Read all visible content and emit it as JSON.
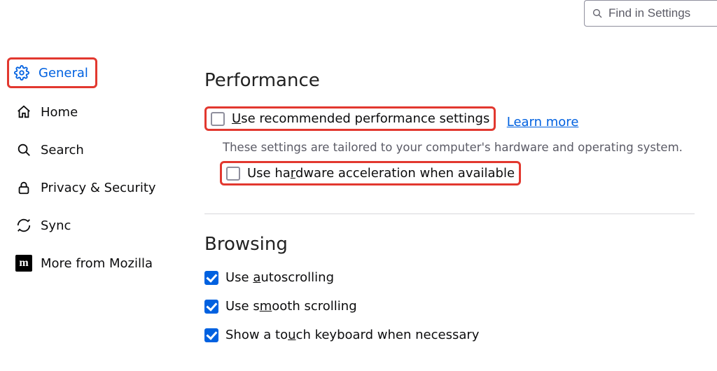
{
  "search": {
    "placeholder": "Find in Settings"
  },
  "sidebar": {
    "items": [
      {
        "label": "General"
      },
      {
        "label": "Home"
      },
      {
        "label": "Search"
      },
      {
        "label": "Privacy & Security"
      },
      {
        "label": "Sync"
      },
      {
        "label": "More from Mozilla"
      }
    ]
  },
  "performance": {
    "heading": "Performance",
    "recommended_pre": "",
    "recommended_u": "U",
    "recommended_post": "se recommended performance settings",
    "learn_more": "Learn more",
    "desc": "These settings are tailored to your computer's hardware and operating system.",
    "hw_pre": "Use ha",
    "hw_u": "r",
    "hw_post": "dware acceleration when available"
  },
  "browsing": {
    "heading": "Browsing",
    "auto_pre": "Use ",
    "auto_u": "a",
    "auto_post": "utoscrolling",
    "smooth_pre": "Use s",
    "smooth_u": "m",
    "smooth_post": "ooth scrolling",
    "touch_pre": "Show a to",
    "touch_u": "u",
    "touch_post": "ch keyboard when necessary"
  }
}
